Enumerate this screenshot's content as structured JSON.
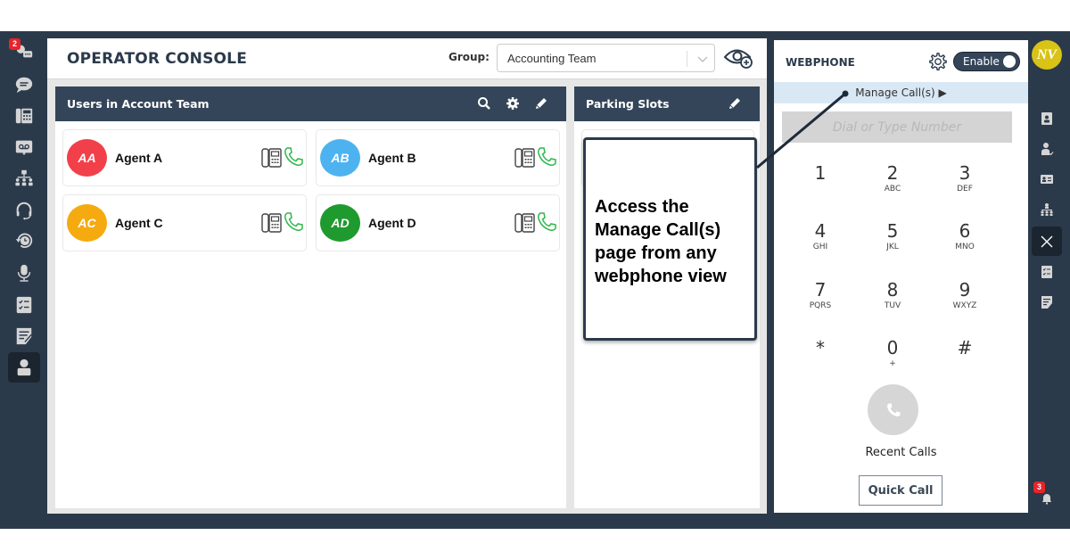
{
  "left_nav": {
    "items": [
      {
        "name": "chat-group",
        "badge": "2"
      },
      {
        "name": "chat"
      },
      {
        "name": "desk-phone"
      },
      {
        "name": "voicemail"
      },
      {
        "name": "org-chart"
      },
      {
        "name": "headset"
      },
      {
        "name": "call-history"
      },
      {
        "name": "microphone"
      },
      {
        "name": "checklist"
      },
      {
        "name": "notes"
      },
      {
        "name": "operator",
        "active": true
      }
    ]
  },
  "header": {
    "title": "OPERATOR CONSOLE",
    "group_label": "Group:",
    "group_value": "Accounting Team"
  },
  "users_panel": {
    "title": "Users in Account Team",
    "agents": [
      {
        "initials": "AA",
        "name": "Agent A",
        "color": "#f2404a"
      },
      {
        "initials": "AB",
        "name": "Agent B",
        "color": "#4db3f0"
      },
      {
        "initials": "AC",
        "name": "Agent C",
        "color": "#f5aa10"
      },
      {
        "initials": "AD",
        "name": "Agent D",
        "color": "#1f9a2e"
      }
    ]
  },
  "parking_panel": {
    "title": "Parking Slots"
  },
  "callout": {
    "text": "Access the Manage Call(s) page from any webphone view"
  },
  "webphone": {
    "title": "WEBPHONE",
    "toggle_label": "Enable",
    "toggle_on": true,
    "manage_calls": "Manage Call(s) ▶",
    "dial_placeholder": "Dial or Type Number",
    "keys": [
      {
        "digit": "1",
        "letters": ""
      },
      {
        "digit": "2",
        "letters": "ABC"
      },
      {
        "digit": "3",
        "letters": "DEF"
      },
      {
        "digit": "4",
        "letters": "GHI"
      },
      {
        "digit": "5",
        "letters": "JKL"
      },
      {
        "digit": "6",
        "letters": "MNO"
      },
      {
        "digit": "7",
        "letters": "PQRS"
      },
      {
        "digit": "8",
        "letters": "TUV"
      },
      {
        "digit": "9",
        "letters": "WXYZ"
      },
      {
        "digit": "*",
        "letters": ""
      },
      {
        "digit": "0",
        "letters": "+"
      },
      {
        "digit": "#",
        "letters": ""
      }
    ],
    "recent_calls": "Recent Calls",
    "quick_call": "Quick Call"
  },
  "right_nav": {
    "user_initials": "NV",
    "notification_count": "3"
  }
}
